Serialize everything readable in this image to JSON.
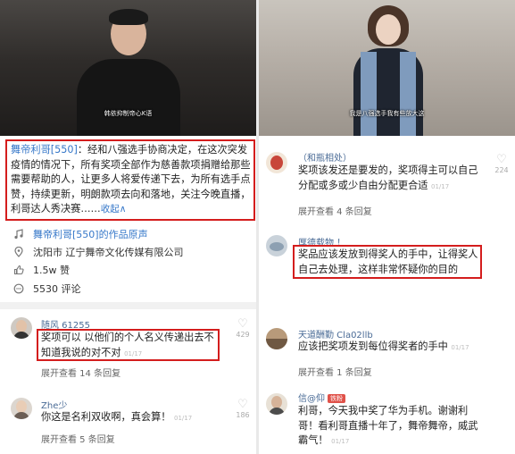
{
  "left": {
    "video_caption": "韩依抑制帝心K语",
    "description": {
      "author": "舞帝利哥[550]",
      "text": "：经和八强选手协商决定，在这次突发疫情的情况下，所有奖项全部作为慈善款项捐赠给那些需要帮助的人，让更多人将爱传递下去，为所有选手点赞，持续更新，明朗款项去向和落地，关注今晚直播，利哥达人秀决赛……",
      "fold": "收起∧"
    },
    "meta": {
      "sound": "舞帝利哥[550]的作品原声",
      "location": "沈阳市 辽宁舞帝文化传媒有限公司",
      "likes": "1.5w 赞",
      "comments": "5530 评论"
    },
    "comments": [
      {
        "name": "随风 61255",
        "text": "奖项可以 以他们的个人名义传递出去不知道我说的对不对",
        "date": "01/17",
        "like_count": "429",
        "more": "展开查看 14 条回复"
      },
      {
        "name": "Zhe少",
        "text": "你这是名利双收啊，真会算！",
        "date": "01/17",
        "like_count": "186",
        "more": "展开查看 5 条回复"
      }
    ]
  },
  "right": {
    "video_caption": "我是八强选手我有些放大这",
    "comments": [
      {
        "name": "（和瓶相处）",
        "text": "奖项该发还是要发的，奖项得主可以自己分配或多或少自由分配更合适",
        "date": "01/17",
        "like_count": "224",
        "more": "展开查看 4 条回复"
      },
      {
        "name": "厚德载物 ！",
        "text": "奖品应该发放到得奖人的手中，让得奖人自己去处理，这样非常怀疑你的目的",
        "date": "",
        "like_count": "",
        "more": ""
      },
      {
        "name": "天道酬勤 Cla02llb",
        "text": "应该把奖项发到每位得奖者的手中",
        "date": "01/17",
        "like_count": "",
        "more": "展开查看 1 条回复"
      },
      {
        "name": "信@仰",
        "badge": "铁粉",
        "text": "利哥，今天我中奖了华为手机。谢谢利哥！看利哥直播十年了，舞帝舞帝，威武霸气！",
        "date": "01/17",
        "like_count": "",
        "more": "展开查看 1 条回复"
      }
    ]
  },
  "colors": {
    "highlight_border": "#d41d1d",
    "link_blue": "#3778c9",
    "name_blue": "#4a6b96"
  },
  "icons": [
    "music-note-icon",
    "location-pin-icon",
    "thumbs-up-icon",
    "comment-icon",
    "heart-icon"
  ]
}
